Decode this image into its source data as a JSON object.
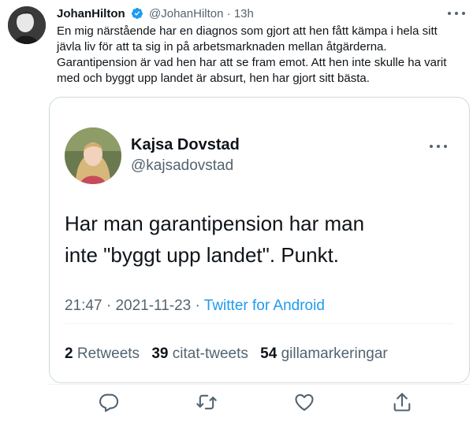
{
  "tweet": {
    "author_name": "JohanHilton",
    "author_handle": "@JohanHilton",
    "separator": "·",
    "time": "13h",
    "text_lines": [
      "En mig närstående har en diagnos som gjort att hen fått kämpa i hela sitt",
      "jävla liv för att ta sig in på arbetsmarknaden mellan åtgärderna.",
      "Garantipension är vad hen har att se fram emot. Att hen inte skulle ha varit",
      "med och byggt upp landet är absurt, hen har gjort sitt bästa."
    ]
  },
  "quoted": {
    "author_name": "Kajsa Dovstad",
    "author_handle": "@kajsadovstad",
    "text_lines": [
      "Har man garantipension har man",
      "inte \"byggt upp landet\". Punkt."
    ],
    "time": "21:47",
    "date": "2021-11-23",
    "separator": "·",
    "source": "Twitter for Android",
    "stats": {
      "retweets_count": "2",
      "retweets_label": "Retweets",
      "quotes_count": "39",
      "quotes_label": "citat-tweets",
      "likes_count": "54",
      "likes_label": "gillamarkeringar"
    }
  },
  "icons": {
    "verified": "verified-badge-icon",
    "more": "more-horizontal-icon",
    "reply": "reply-icon",
    "retweet": "retweet-icon",
    "like": "heart-icon",
    "share": "share-icon"
  },
  "colors": {
    "accent": "#1d9bf0",
    "text": "#0f1419",
    "secondary": "#536471",
    "border": "#cfd9de"
  }
}
